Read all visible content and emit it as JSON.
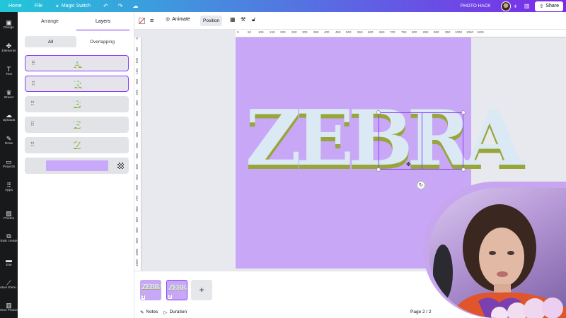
{
  "topbar": {
    "home": "Home",
    "file": "File",
    "magic_switch": "Magic Switch",
    "design_title": "PHOTO HACK",
    "share": "Share"
  },
  "left_nav": {
    "items": [
      {
        "label": "Design",
        "icon": "layout-icon"
      },
      {
        "label": "Elements",
        "icon": "shapes-icon"
      },
      {
        "label": "Text",
        "icon": "text-icon"
      },
      {
        "label": "Brand",
        "icon": "crown-icon"
      },
      {
        "label": "Uploads",
        "icon": "cloud-upload-icon"
      },
      {
        "label": "Draw",
        "icon": "pen-icon"
      },
      {
        "label": "Projects",
        "icon": "folder-icon"
      },
      {
        "label": "Apps",
        "icon": "apps-grid-icon"
      },
      {
        "label": "Photos",
        "icon": "image-icon"
      },
      {
        "label": "Bulk create",
        "icon": "bulk-create-icon"
      },
      {
        "label": "Elle",
        "icon": "elle-app-icon"
      },
      {
        "label": "ative Elem...",
        "icon": "creative-elements-icon"
      },
      {
        "label": "rfect Photos",
        "icon": "perfect-photos-icon"
      }
    ]
  },
  "layers_panel": {
    "tabs": [
      "Arrange",
      "Layers"
    ],
    "active_tab": "Layers",
    "filters": [
      "All",
      "Overlapping"
    ],
    "active_filter": "All",
    "layers": [
      {
        "letter": "A",
        "selected": true
      },
      {
        "letter": "R",
        "selected": true
      },
      {
        "letter": "B",
        "selected": false
      },
      {
        "letter": "E",
        "selected": false
      },
      {
        "letter": "Z",
        "selected": false
      }
    ],
    "background_color": "#c8a8f8"
  },
  "context_toolbar": {
    "animate": "Animate",
    "position": "Position"
  },
  "ruler": {
    "top": [
      "0",
      "50",
      "100",
      "150",
      "200",
      "250",
      "300",
      "350",
      "400",
      "450",
      "500",
      "550",
      "600",
      "650",
      "700",
      "750",
      "800",
      "850",
      "900",
      "950",
      "1000",
      "1050",
      "1100"
    ],
    "left": [
      "0",
      "50",
      "100",
      "150",
      "200",
      "250",
      "300",
      "350",
      "400",
      "450",
      "500",
      "550",
      "600",
      "650",
      "700",
      "750",
      "800",
      "850",
      "900",
      "950",
      "1000",
      "1050"
    ]
  },
  "canvas": {
    "text": "ZEBRA",
    "background": "#c9a7f7",
    "letter_fill": "#dbe9f4",
    "letter_ground": "#97a53a",
    "selection_color": "#8b3dff"
  },
  "pages": {
    "thumbs": [
      {
        "number": "1",
        "word": "ZEBRA",
        "selected": false
      },
      {
        "number": "2",
        "word": "ZEBRA",
        "selected": true
      }
    ],
    "add": "+"
  },
  "bottombar": {
    "notes": "Notes",
    "duration": "Duration",
    "page_count": "Page 2 / 2"
  }
}
